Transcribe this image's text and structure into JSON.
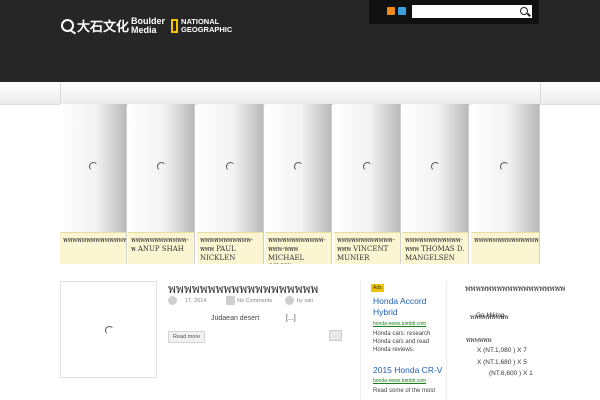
{
  "header": {
    "logo_cn": "大石文化",
    "logo_en_1": "Boulder",
    "logo_en_2": "Media",
    "ng_1": "NATIONAL",
    "ng_2": "GEOGRAPHIC",
    "search_placeholder": ""
  },
  "slider": {
    "captions": [
      "พพพพพพพพพพพพพพพพ",
      "พพพพพพพพพพพพ-พ ANUP SHAH",
      "พพพพพพพพพพพ-พพพ PAUL NICKLEN",
      "พพพพพพพพพพพพ-พพพ-พพพ MICHAEL 'NICK' NICHOLS",
      "พพพพพพพพพพพพ-พพพ VINCENT MUNIER",
      "พพพพพพพพพพพพ-พพพ THOMAS D. MANGELSEN",
      "พพพพพพพพพพพพพพพพ"
    ]
  },
  "post": {
    "title": "พพพพพพพพพพพพพพพพพพพ",
    "date": "17, 2014",
    "comments": "No Comments",
    "author": "by san",
    "excerpt": "Judaean desert",
    "ellipsis": "[...]",
    "read_more": "Read more"
  },
  "ads": {
    "badge": "Ads",
    "items": [
      {
        "title": "Honda Accord Hybrid",
        "url": "honda-news.tumblr.com",
        "text": "Honda cars: research Honda cars and read Honda reviews."
      },
      {
        "title": "2015 Honda CR-V",
        "url": "honda-news.tumblr.com",
        "text": "Read some of the most"
      }
    ]
  },
  "sidebar": {
    "title": "พพพพพพพพพพพพพพพพพพพ",
    "lines": [
      "พพพพพพพพพ",
      "Go Hiking",
      "พพพพพพ",
      "X (NT.1,080 ) X 7",
      "X (NT.1,680 ) X 5",
      "(NT.6,600 ) X 1"
    ]
  }
}
